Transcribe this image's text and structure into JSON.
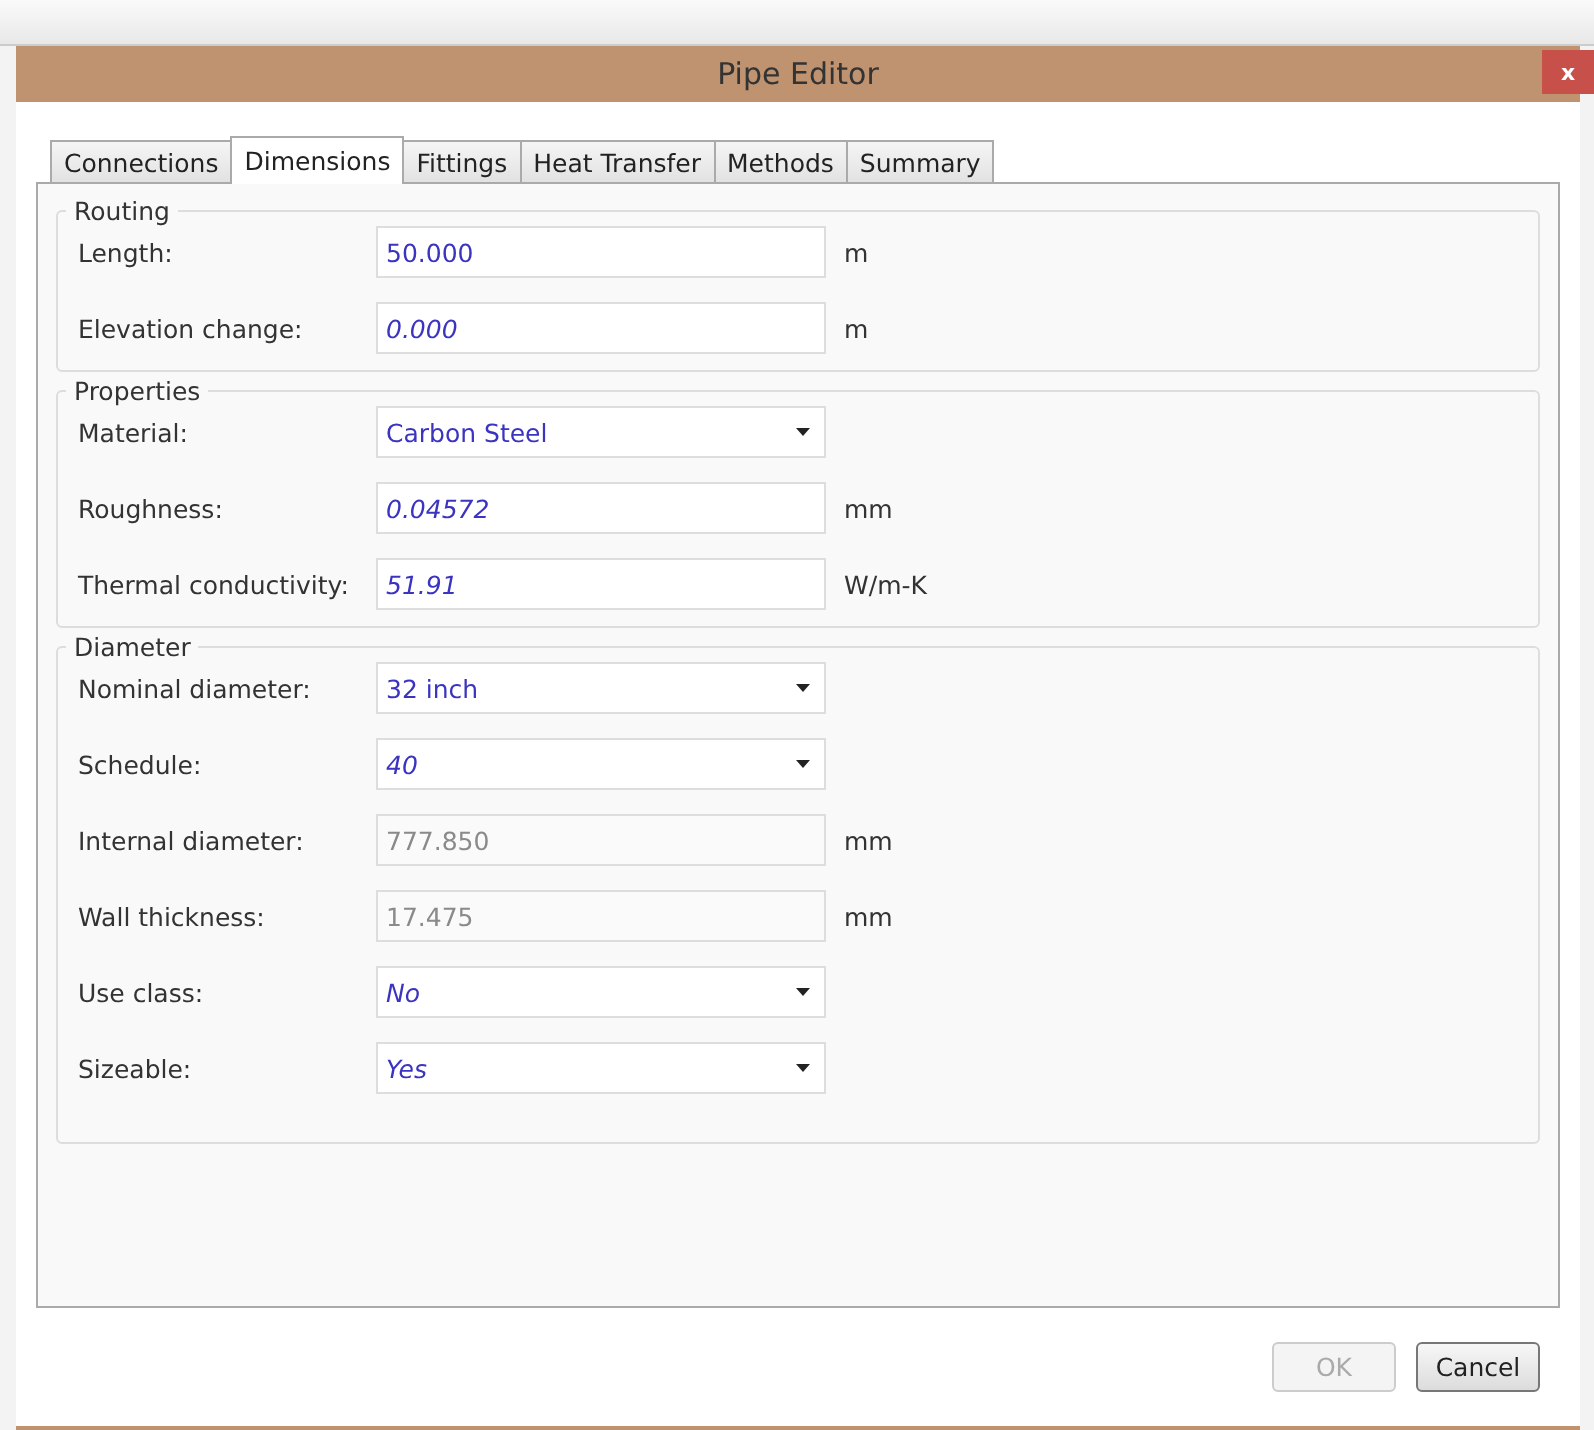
{
  "window": {
    "title": "Pipe Editor",
    "close": "x"
  },
  "tabs": [
    {
      "label": "Connections",
      "selected": false
    },
    {
      "label": "Dimensions",
      "selected": true
    },
    {
      "label": "Fittings",
      "selected": false
    },
    {
      "label": "Heat Transfer",
      "selected": false
    },
    {
      "label": "Methods",
      "selected": false
    },
    {
      "label": "Summary",
      "selected": false
    }
  ],
  "groups": [
    {
      "title": "Routing",
      "fields": [
        {
          "label": "Length:",
          "kind": "text",
          "value": "50.000",
          "italic": false,
          "disabled": false,
          "unit": "m"
        },
        {
          "label": "Elevation change:",
          "kind": "text",
          "value": "0.000",
          "italic": true,
          "disabled": false,
          "unit": "m"
        }
      ]
    },
    {
      "title": "Properties",
      "fields": [
        {
          "label": "Material:",
          "kind": "dropdown",
          "value": "Carbon Steel",
          "italic": false,
          "disabled": false
        },
        {
          "label": "Roughness:",
          "kind": "text",
          "value": "0.04572",
          "italic": true,
          "disabled": false,
          "unit": "mm"
        },
        {
          "label": "Thermal conductivity:",
          "kind": "text",
          "value": "51.91",
          "italic": true,
          "disabled": false,
          "unit": "W/m-K"
        }
      ]
    },
    {
      "title": "Diameter",
      "fields": [
        {
          "label": "Nominal diameter:",
          "kind": "dropdown",
          "value": "32 inch",
          "italic": false,
          "disabled": false
        },
        {
          "label": "Schedule:",
          "kind": "dropdown",
          "value": "40",
          "italic": true,
          "disabled": false
        },
        {
          "label": "Internal diameter:",
          "kind": "text",
          "value": "777.850",
          "italic": false,
          "disabled": true,
          "unit": "mm"
        },
        {
          "label": "Wall thickness:",
          "kind": "text",
          "value": "17.475",
          "italic": false,
          "disabled": true,
          "unit": "mm"
        },
        {
          "label": "Use class:",
          "kind": "dropdown",
          "value": "No",
          "italic": true,
          "disabled": false
        },
        {
          "label": "Sizeable:",
          "kind": "dropdown",
          "value": "Yes",
          "italic": true,
          "disabled": false
        }
      ]
    }
  ],
  "buttons": [
    {
      "label": "OK",
      "disabled": true
    },
    {
      "label": "Cancel",
      "disabled": false
    }
  ]
}
